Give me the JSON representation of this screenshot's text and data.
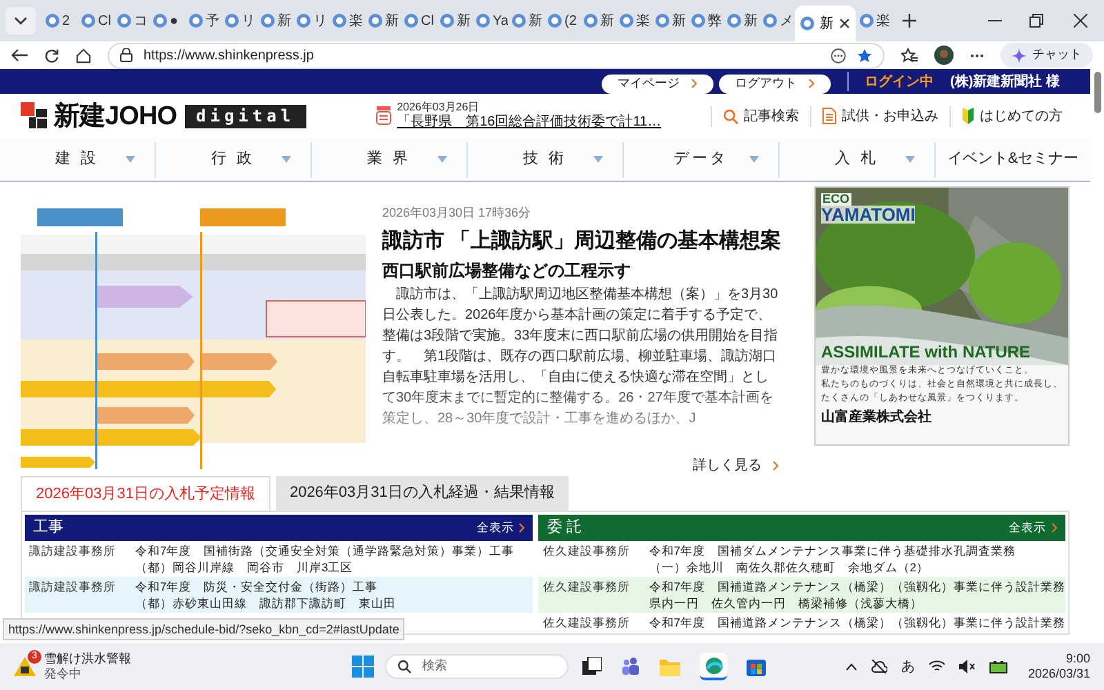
{
  "browser": {
    "tabs": [
      {
        "label": "2",
        "selected": false
      },
      {
        "label": "Cl",
        "selected": false
      },
      {
        "label": "コ",
        "selected": false
      },
      {
        "label": "●",
        "selected": false
      },
      {
        "label": "予",
        "selected": false
      },
      {
        "label": "リ",
        "selected": false
      },
      {
        "label": "新",
        "selected": false
      },
      {
        "label": "リ",
        "selected": false
      },
      {
        "label": "楽",
        "selected": false
      },
      {
        "label": "新",
        "selected": false
      },
      {
        "label": "Cl",
        "selected": false
      },
      {
        "label": "新",
        "selected": false
      },
      {
        "label": "Ya",
        "selected": false
      },
      {
        "label": "新",
        "selected": false
      },
      {
        "label": "(2",
        "selected": false
      },
      {
        "label": "新",
        "selected": false
      },
      {
        "label": "楽",
        "selected": false
      },
      {
        "label": "新",
        "selected": false
      },
      {
        "label": "弊",
        "selected": false
      },
      {
        "label": "新",
        "selected": false
      },
      {
        "label": "メ",
        "selected": false
      },
      {
        "label": "新",
        "selected": true
      },
      {
        "label": "楽",
        "selected": false
      }
    ],
    "url": "https://www.shinkenpress.jp",
    "chat": "チャット"
  },
  "site": {
    "top_links": [
      "マイページ",
      "ログアウト"
    ],
    "login_status": "ログイン中",
    "user": "(株)新建新聞社 様",
    "logo": {
      "main": "新建JOHO",
      "badge": "digital"
    },
    "info": {
      "date": "2026年03月26日",
      "headline": "「長野県　第16回総合評価技術委で計11…"
    },
    "header_links": [
      {
        "label": "記事検索",
        "kind": "search"
      },
      {
        "label": "試供・お申込み",
        "kind": "document"
      },
      {
        "label": "はじめての方",
        "kind": "beginner"
      }
    ],
    "nav": [
      {
        "label": "建 設",
        "has_menu": true
      },
      {
        "label": "行 政",
        "has_menu": true
      },
      {
        "label": "業 界",
        "has_menu": true
      },
      {
        "label": "技 術",
        "has_menu": true
      },
      {
        "label": "データ",
        "has_menu": true
      },
      {
        "label": "入 札",
        "has_menu": true
      },
      {
        "label": "イベント&セミナー",
        "has_menu": false
      }
    ]
  },
  "article": {
    "date": "2026年03月30日 17時36分",
    "title": "諏訪市 「上諏訪駅」周辺整備の基本構想案",
    "subtitle": "西口駅前広場整備などの工程示す",
    "body": "　諏訪市は、「上諏訪駅周辺地区整備基本構想（案）」を3月30日公表した。2026年度から基本計画の策定に着手する予定で、整備は3段階で実施。33年度末に西口駅前広場の供用開始を目指す。　第1段階は、既存の西口駅前広場、柳並駐車場、諏訪湖口自転車駐車場を活用し、「自由に使える快適な滞在空間」として30年度末までに暫定的に整備する。26・27年度で基本計画を策定し、28～30年度で設計・工事を進めるほか、J",
    "more": "詳しく見る"
  },
  "ad": {
    "eco": "ECO",
    "brand": "YAMATOMI",
    "slogan": "ASSIMILATE with NATURE",
    "lines": [
      "豊かな環境や風景を未来へとつなげていくこと。",
      "私たちのものづくりは、社会と自然環境と共に成長し、",
      "たくさんの「しあわせな風景」をつくります。"
    ],
    "company": "山富産業株式会社"
  },
  "bid_tabs": [
    {
      "label": "2026年03月31日の入札予定情報",
      "selected": true
    },
    {
      "label": "2026年03月31日の入札経過・結果情報",
      "selected": false
    }
  ],
  "tables": [
    {
      "title": "工事",
      "more": "全表示",
      "color": "#141a78",
      "rows": [
        {
          "office": "諏訪建設事務所",
          "lines": [
            "令和7年度　国補街路（交通安全対策（通学路緊急対策）事業）工事",
            "（都）岡谷川岸線　岡谷市　川岸3工区"
          ],
          "shaded": false
        },
        {
          "office": "諏訪建設事務所",
          "lines": [
            "令和7年度　防災・安全交付金（街路）工事",
            "（都）赤砂東山田線　諏訪郡下諏訪町　東山田"
          ],
          "shaded": true
        }
      ]
    },
    {
      "title": "委 託",
      "more": "全表示",
      "color": "#0f6b32",
      "rows": [
        {
          "office": "佐久建設事務所",
          "lines": [
            "令和7年度　国補ダムメンテナンス事業に伴う基礎排水孔調査業務",
            "（一）余地川　南佐久郡佐久穂町　余地ダム（2）"
          ],
          "shaded": false
        },
        {
          "office": "佐久建設事務所",
          "lines": [
            "令和7年度　国補道路メンテナンス（橋梁）（強靱化）事業に伴う設計業務",
            "県内一円　佐久管内一円　橋梁補修（浅蓼大橋）"
          ],
          "shaded": true
        },
        {
          "office": "佐久建設事務所",
          "lines": [
            "令和7年度　国補道路メンテナンス（橋梁）（強靱化）事業に伴う設計業務"
          ],
          "shaded": false
        }
      ]
    }
  ],
  "status_url": "https://www.shinkenpress.jp/schedule-bid/?seko_kbn_cd=2#lastUpdate",
  "taskbar": {
    "alert_count": "3",
    "alert_title": "雪解け洪水警報",
    "alert_sub": "発令中",
    "search": "検索",
    "ime": "あ",
    "time": "9:00",
    "date": "2026/03/31"
  }
}
